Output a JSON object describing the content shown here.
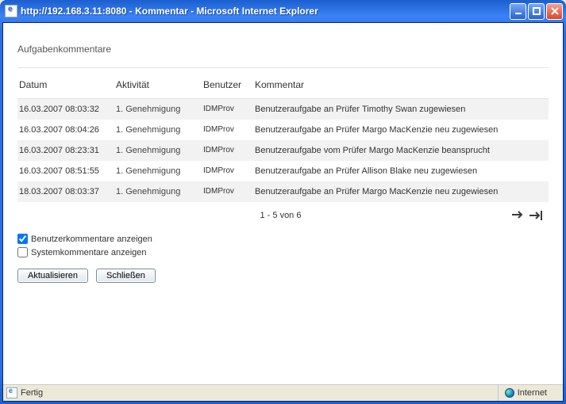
{
  "window": {
    "title": "http://192.168.3.11:8080 - Kommentar - Microsoft Internet Explorer"
  },
  "panel": {
    "title": "Aufgabenkommentare"
  },
  "headers": {
    "datum": "Datum",
    "aktivitaet": "Aktivität",
    "benutzer": "Benutzer",
    "kommentar": "Kommentar"
  },
  "rows": [
    {
      "datum": "16.03.2007 08:03:32",
      "aktivitaet": "1. Genehmigung",
      "benutzer": "IDMProv",
      "kommentar": "Benutzeraufgabe an Prüfer Timothy Swan zugewiesen"
    },
    {
      "datum": "16.03.2007 08:04:26",
      "aktivitaet": "1. Genehmigung",
      "benutzer": "IDMProv",
      "kommentar": "Benutzeraufgabe an Prüfer Margo MacKenzie neu zugewiesen"
    },
    {
      "datum": "16.03.2007 08:23:31",
      "aktivitaet": "1. Genehmigung",
      "benutzer": "IDMProv",
      "kommentar": "Benutzeraufgabe vom Prüfer Margo MacKenzie beansprucht"
    },
    {
      "datum": "16.03.2007 08:51:55",
      "aktivitaet": "1. Genehmigung",
      "benutzer": "IDMProv",
      "kommentar": "Benutzeraufgabe an Prüfer Allison Blake neu zugewiesen"
    },
    {
      "datum": "18.03.2007 08:03:37",
      "aktivitaet": "1. Genehmigung",
      "benutzer": "IDMProv",
      "kommentar": "Benutzeraufgabe an Prüfer Margo MacKenzie neu zugewiesen"
    }
  ],
  "pager": {
    "text": "1 - 5 von 6"
  },
  "checks": {
    "user_comments": {
      "label": "Benutzerkommentare anzeigen",
      "checked": true
    },
    "system_comments": {
      "label": "Systemkommentare anzeigen",
      "checked": false
    }
  },
  "buttons": {
    "refresh": "Aktualisieren",
    "close": "Schließen"
  },
  "status": {
    "left": "Fertig",
    "zone": "Internet"
  }
}
